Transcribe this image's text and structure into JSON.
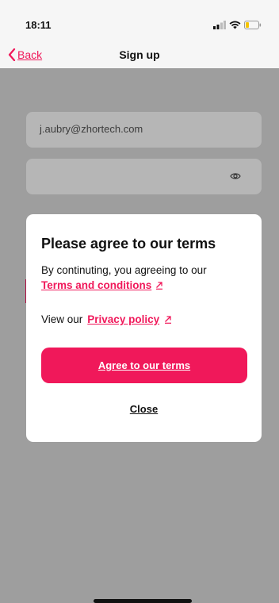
{
  "status_bar": {
    "time": "18:11",
    "icons": [
      "signal-icon",
      "wifi-icon",
      "battery-icon"
    ]
  },
  "nav": {
    "back_label": "Back",
    "title": "Sign up"
  },
  "form": {
    "email_value": "j.aubry@zhortech.com",
    "password_value": ""
  },
  "modal": {
    "title": "Please agree to our terms",
    "line1": "By continuting, you agreeing to our",
    "terms_link": "Terms and conditions",
    "privacy_prefix": "View our",
    "privacy_link": "Privacy policy",
    "agree_button": "Agree to our terms",
    "close_button": "Close"
  },
  "colors": {
    "accent": "#f0185a",
    "overlay": "#9e9e9e"
  }
}
